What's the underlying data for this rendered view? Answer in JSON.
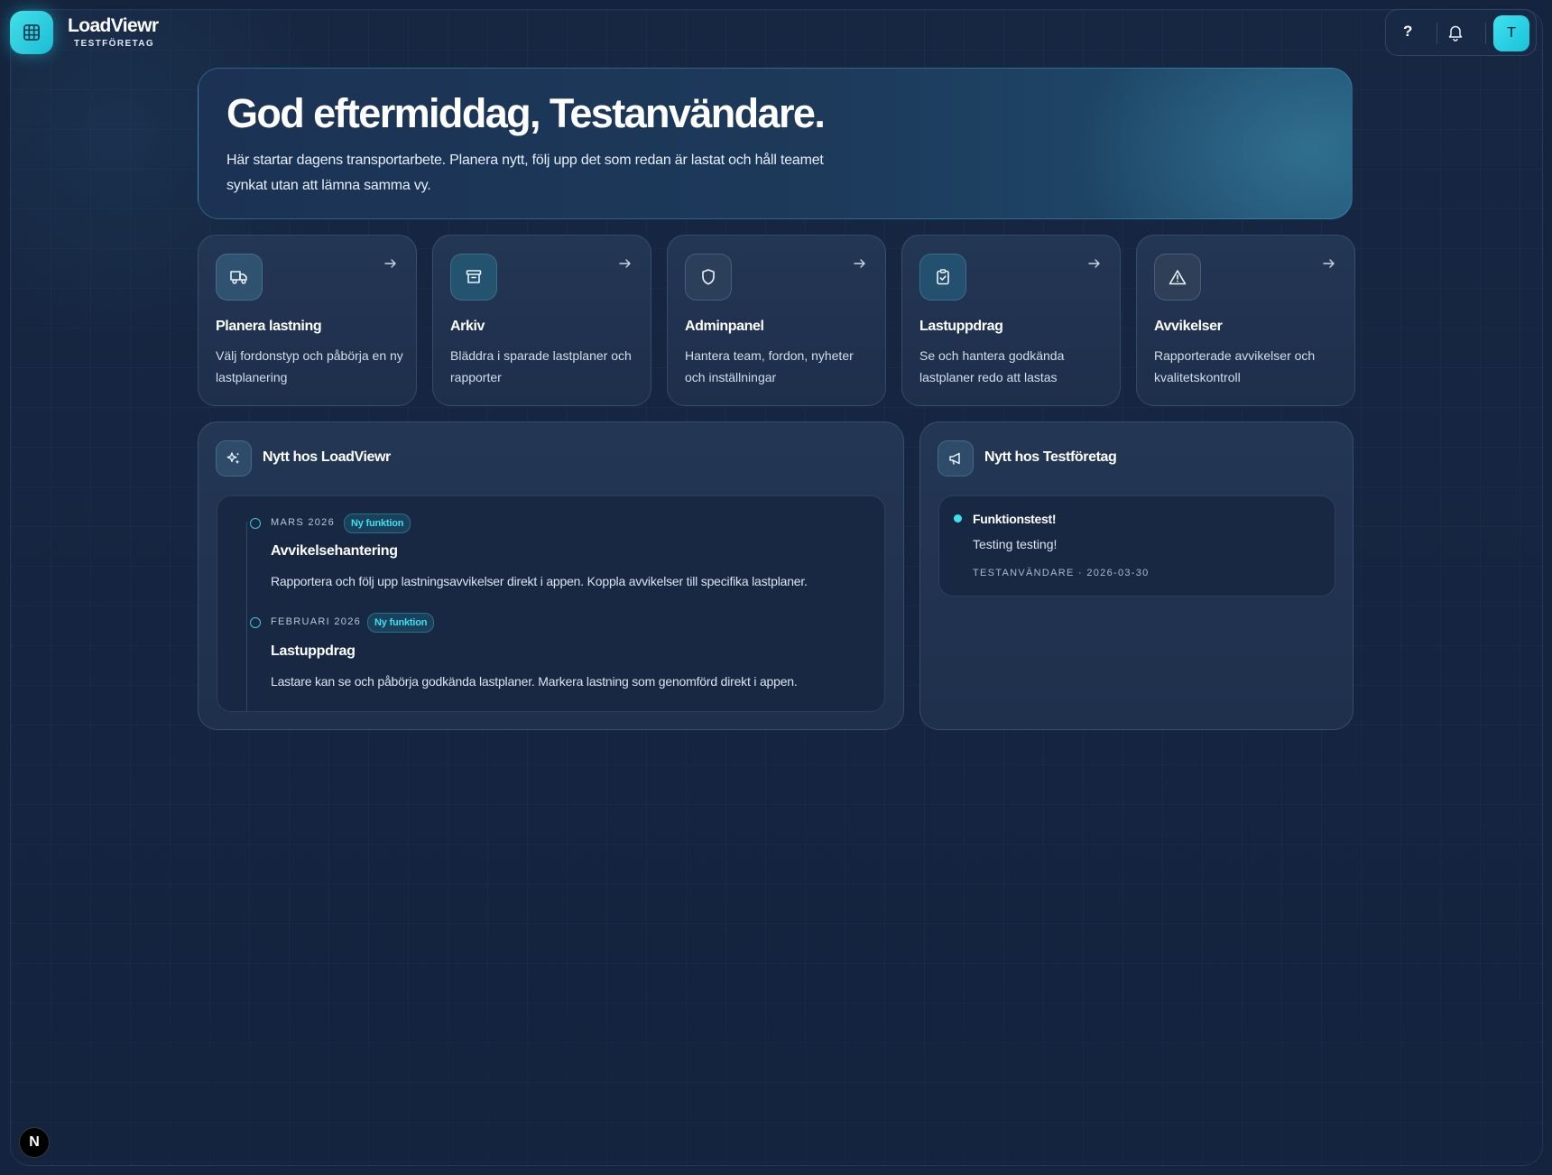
{
  "brand": {
    "name": "LoadViewr",
    "company": "TESTFÖRETAG"
  },
  "toolbar": {
    "help_label": "?",
    "avatar_initial": "T"
  },
  "hero": {
    "title": "God eftermiddag, Testanvändare.",
    "text": "Här startar dagens transportarbete. Planera nytt, följ upp det som redan är lastat och håll teamet synkat utan att lämna samma vy."
  },
  "cards": [
    {
      "title": "Planera lastning",
      "desc": "Välj fordonstyp och påbörja en ny lastplanering",
      "icon": "truck-icon"
    },
    {
      "title": "Arkiv",
      "desc": "Bläddra i sparade lastplaner och rapporter",
      "icon": "archive-icon"
    },
    {
      "title": "Adminpanel",
      "desc": "Hantera team, fordon, nyheter och inställningar",
      "icon": "shield-icon"
    },
    {
      "title": "Lastuppdrag",
      "desc": "Se och hantera godkända lastplaner redo att lastas",
      "icon": "clipboard-check-icon"
    },
    {
      "title": "Avvikelser",
      "desc": "Rapporterade avvikelser och kvalitetskontroll",
      "icon": "warning-triangle-icon"
    }
  ],
  "news_loadviewr": {
    "title": "Nytt hos LoadViewr",
    "items": [
      {
        "date": "MARS 2026",
        "badge": "Ny funktion",
        "title": "Avvikelsehantering",
        "desc": "Rapportera och följ upp lastningsavvikelser direkt i appen. Koppla avvikelser till specifika lastplaner."
      },
      {
        "date": "FEBRUARI 2026",
        "badge": "Ny funktion",
        "title": "Lastuppdrag",
        "desc": "Lastare kan se och påbörja godkända lastplaner. Markera lastning som genomförd direkt i appen."
      }
    ]
  },
  "news_company": {
    "title": "Nytt hos Testföretag",
    "post": {
      "title": "Funktionstest!",
      "body": "Testing testing!",
      "meta": "TESTANVÄNDARE · 2026-03-30"
    }
  },
  "dev_badge": "N",
  "colors": {
    "accent": "#3fe0ee",
    "background": "#15243e",
    "card": "#223553"
  }
}
